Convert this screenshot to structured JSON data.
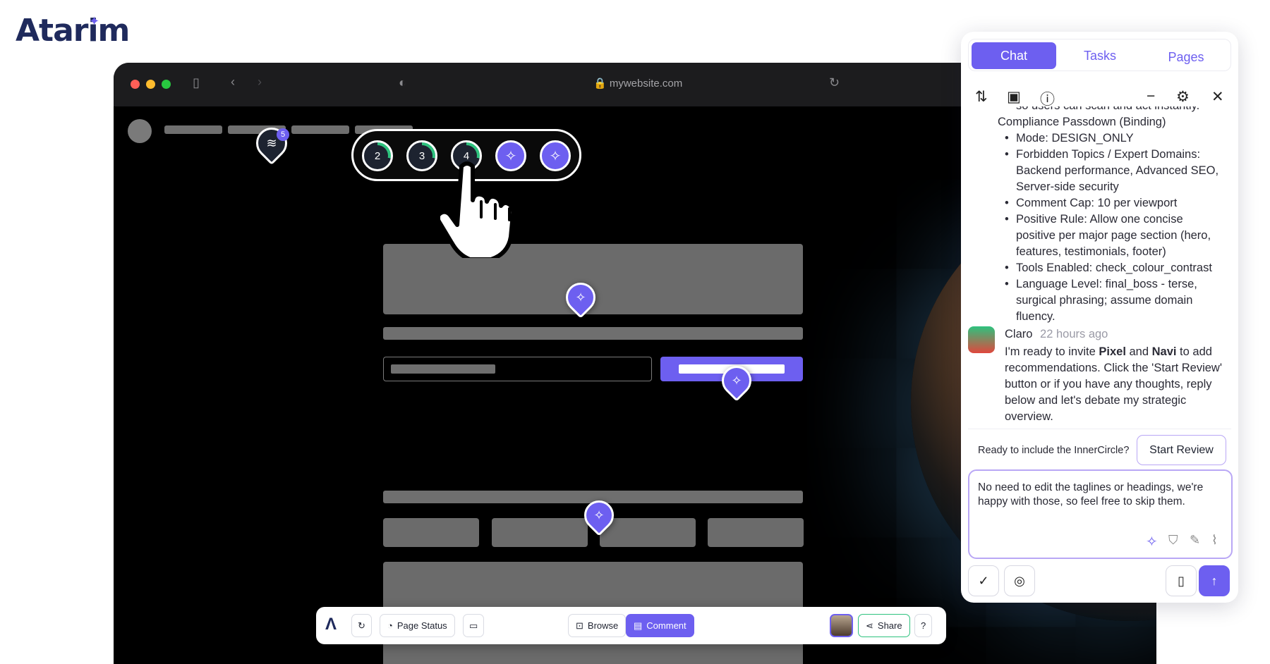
{
  "brand": {
    "logo_text": "Atarim",
    "accent": "#6d5ff0"
  },
  "browser": {
    "url": "mywebsite.com",
    "traffic_lights": [
      "#ff5f57",
      "#febc2e",
      "#28c840"
    ]
  },
  "layers_badge": {
    "count": "5"
  },
  "cluster": {
    "numbers": [
      "2",
      "3",
      "4"
    ]
  },
  "toolbar": {
    "page_status": "Page Status",
    "browse": "Browse",
    "comment": "Comment",
    "share": "Share"
  },
  "panel": {
    "tabs": [
      "Chat",
      "Tasks",
      "Pages"
    ],
    "thread": {
      "top_line": "so users can scan and act instantly.",
      "section_title": "Compliance Passdown (Binding)",
      "bullets": [
        "Mode: DESIGN_ONLY",
        "Forbidden Topics / Expert Domains: Backend performance, Advanced SEO, Server-side security",
        "Comment Cap: 10 per viewport",
        "Positive Rule: Allow one concise positive per major page section (hero, features, testimonials, footer)",
        "Tools Enabled: check_colour_contrast",
        "Language Level: final_boss - terse, surgical phrasing; assume domain fluency."
      ],
      "message": {
        "author": "Claro",
        "time": "22 hours ago",
        "text_1": "I'm ready to invite ",
        "bold_1": "Pixel",
        "text_2": " and ",
        "bold_2": "Navi",
        "text_3": " to add recommendations. Click the 'Start Review' button or if you have any thoughts, reply below and let's debate my strategic overview."
      }
    },
    "prompt": {
      "question": "Ready to include the InnerCircle?",
      "button": "Start Review"
    },
    "composer": {
      "text": "No need to edit the taglines or headings, we're happy with those, so feel free to skip them."
    }
  }
}
